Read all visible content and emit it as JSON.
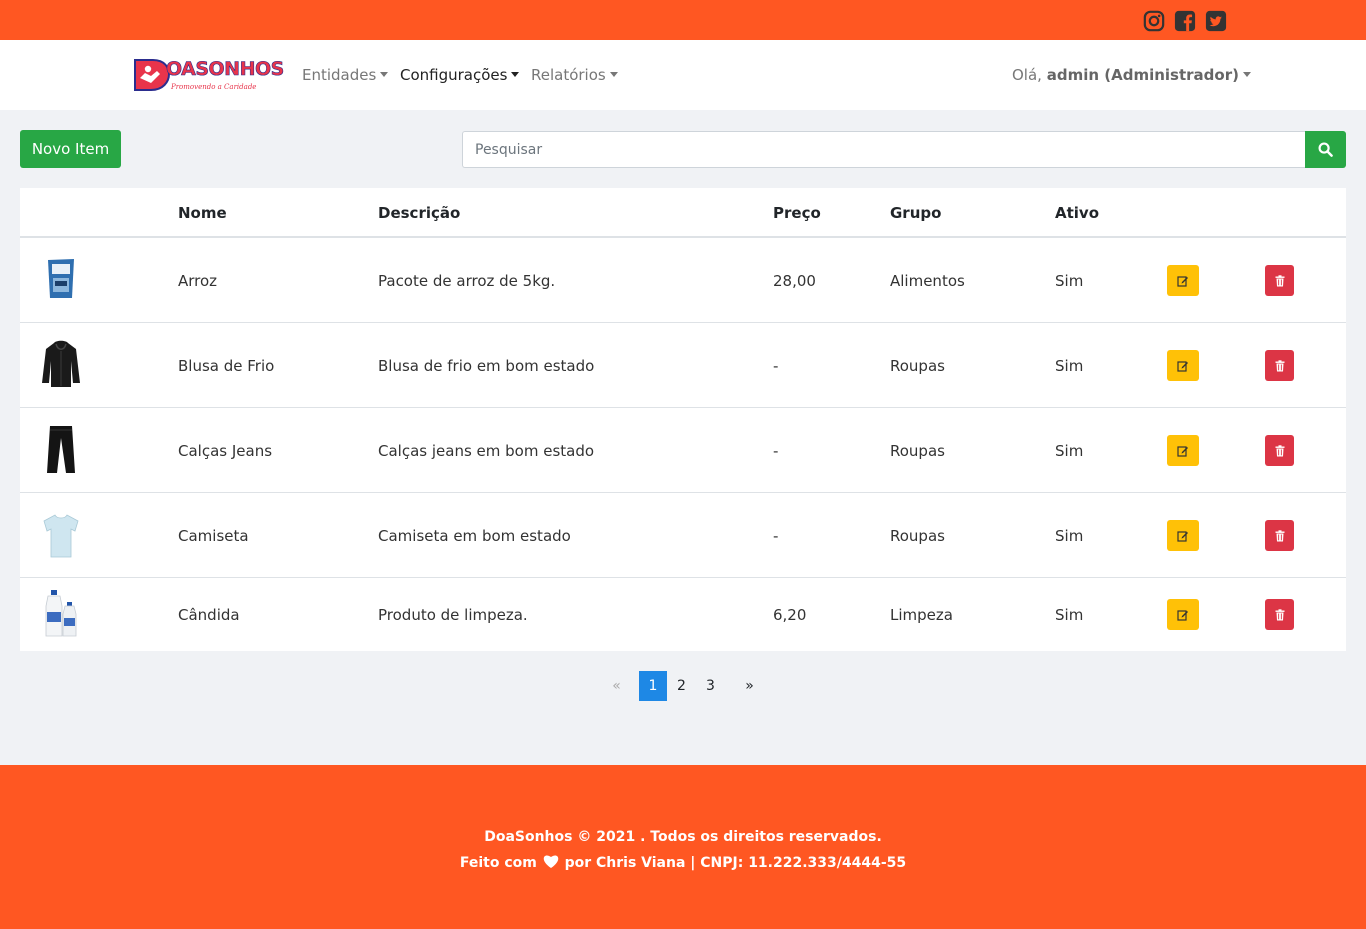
{
  "brand": {
    "name": "OASONHOS",
    "tagline": "Promovendo a Caridade",
    "colors": {
      "primary": "#e8344b",
      "outline": "#2b2d8e"
    }
  },
  "theme": {
    "topbar": "#ff5722",
    "success": "#28a745",
    "warning": "#ffc107",
    "danger": "#dc3545",
    "page_active": "#1e88e5"
  },
  "social": [
    "instagram-icon",
    "facebook-icon",
    "twitter-icon"
  ],
  "nav": {
    "items": [
      {
        "label": "Entidades"
      },
      {
        "label": "Configurações"
      },
      {
        "label": "Relatórios"
      }
    ],
    "user_greeting": "Olá,",
    "user_name": "admin (Administrador)"
  },
  "toolbar": {
    "new_label": "Novo Item",
    "search_placeholder": "Pesquisar"
  },
  "table": {
    "headers": {
      "nome": "Nome",
      "descricao": "Descrição",
      "preco": "Preço",
      "grupo": "Grupo",
      "ativo": "Ativo"
    },
    "rows": [
      {
        "nome": "Arroz",
        "descricao": "Pacote de arroz de 5kg.",
        "preco": "28,00",
        "grupo": "Alimentos",
        "ativo": "Sim",
        "icon": "rice-bag-icon"
      },
      {
        "nome": "Blusa de Frio",
        "descricao": "Blusa de frio em bom estado",
        "preco": "-",
        "grupo": "Roupas",
        "ativo": "Sim",
        "icon": "hoodie-icon"
      },
      {
        "nome": "Calças Jeans",
        "descricao": "Calças jeans em bom estado",
        "preco": "-",
        "grupo": "Roupas",
        "ativo": "Sim",
        "icon": "pants-icon"
      },
      {
        "nome": "Camiseta",
        "descricao": "Camiseta em bom estado",
        "preco": "-",
        "grupo": "Roupas",
        "ativo": "Sim",
        "icon": "tshirt-icon"
      },
      {
        "nome": "Cândida",
        "descricao": "Produto de limpeza.",
        "preco": "6,20",
        "grupo": "Limpeza",
        "ativo": "Sim",
        "icon": "bleach-bottles-icon"
      }
    ]
  },
  "pagination": {
    "prev": "«",
    "pages": [
      "1",
      "2",
      "3"
    ],
    "next": "»",
    "current": "1"
  },
  "footer": {
    "line1": "DoaSonhos © 2021 . Todos os direitos reservados.",
    "line2_prefix": "Feito com",
    "line2_suffix": "por Chris Viana | CNPJ: 11.222.333/4444-55"
  }
}
